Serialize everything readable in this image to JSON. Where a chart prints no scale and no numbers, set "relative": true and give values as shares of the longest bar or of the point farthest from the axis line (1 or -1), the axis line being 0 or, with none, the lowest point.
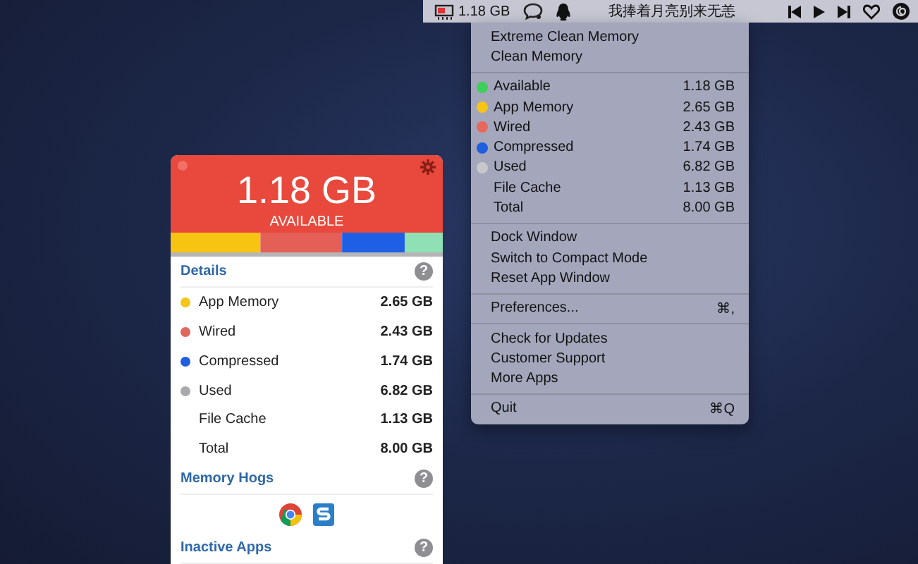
{
  "menubar": {
    "memory_reading": "1.18 GB",
    "song_title": "我捧着月亮别来无恙"
  },
  "menu": {
    "sections": [
      {
        "items": [
          {
            "kind": "plain",
            "label": "Extreme Clean Memory"
          },
          {
            "kind": "plain",
            "label": "Clean Memory"
          }
        ]
      },
      {
        "items": [
          {
            "kind": "stat",
            "label": "Available",
            "value": "1.18 GB",
            "color": "#3ecf5a"
          },
          {
            "kind": "stat",
            "label": "App Memory",
            "value": "2.65 GB",
            "color": "#f5c518"
          },
          {
            "kind": "stat",
            "label": "Wired",
            "value": "2.43 GB",
            "color": "#e8675c"
          },
          {
            "kind": "stat",
            "label": "Compressed",
            "value": "1.74 GB",
            "color": "#1f5fe0"
          },
          {
            "kind": "stat",
            "label": "Used",
            "value": "6.82 GB",
            "color": "#c8c8cc"
          },
          {
            "kind": "stat",
            "label": "File Cache",
            "value": "1.13 GB"
          },
          {
            "kind": "stat",
            "label": "Total",
            "value": "8.00 GB"
          }
        ]
      },
      {
        "items": [
          {
            "kind": "plain",
            "label": "Dock Window"
          },
          {
            "kind": "plain",
            "label": "Switch to Compact Mode"
          },
          {
            "kind": "plain",
            "label": "Reset App Window"
          }
        ]
      },
      {
        "items": [
          {
            "kind": "shortcut",
            "label": "Preferences...",
            "shortcut": "⌘,"
          }
        ]
      },
      {
        "items": [
          {
            "kind": "plain",
            "label": "Check for Updates"
          },
          {
            "kind": "plain",
            "label": "Customer Support"
          },
          {
            "kind": "plain",
            "label": "More Apps"
          }
        ]
      },
      {
        "items": [
          {
            "kind": "shortcut",
            "label": "Quit",
            "shortcut": "⌘Q"
          }
        ]
      }
    ]
  },
  "panel": {
    "amount": "1.18 GB",
    "caption": "AVAILABLE",
    "usage_bar": {
      "chart_data": {
        "type": "bar",
        "orientation": "horizontal",
        "stacked": true,
        "relative": true,
        "series": [
          {
            "color": "#f7c412",
            "values": [
              0.33
            ]
          },
          {
            "color": "#e45f55",
            "values": [
              0.3
            ]
          },
          {
            "color": "#1f5fe6",
            "values": [
              0.23
            ]
          },
          {
            "color": "#8fe0b4",
            "values": [
              0.14
            ]
          }
        ]
      }
    },
    "details": {
      "title": "Details",
      "help": "?",
      "rows": [
        {
          "label": "App Memory",
          "value": "2.65 GB",
          "color": "#f5c518"
        },
        {
          "label": "Wired",
          "value": "2.43 GB",
          "color": "#e0675c"
        },
        {
          "label": "Compressed",
          "value": "1.74 GB",
          "color": "#1f5fe0"
        },
        {
          "label": "Used",
          "value": "6.82 GB",
          "color": "#a9a9ad"
        },
        {
          "label": "File Cache",
          "value": "1.13 GB"
        },
        {
          "label": "Total",
          "value": "8.00 GB"
        }
      ]
    },
    "memory_hogs": {
      "title": "Memory Hogs",
      "help": "?"
    },
    "inactive_apps": {
      "title": "Inactive Apps",
      "help": "?"
    }
  }
}
